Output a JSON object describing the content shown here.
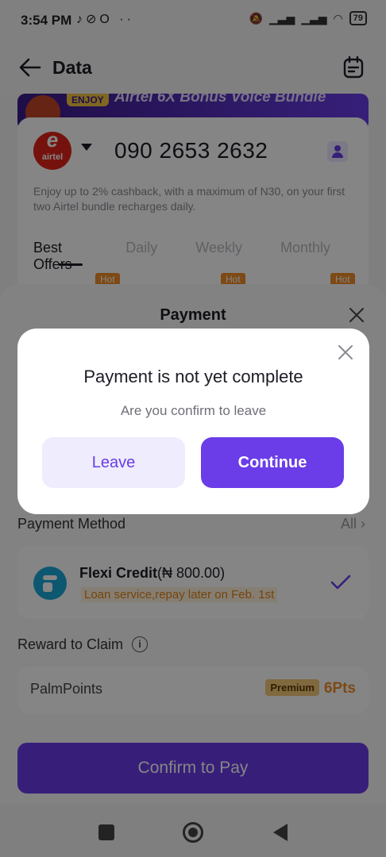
{
  "status_bar": {
    "time": "3:54 PM",
    "left_icons": [
      "tiktok-icon",
      "no-entry-icon",
      "opera-icon",
      "more-dots-icon"
    ],
    "battery": "79"
  },
  "app_bar": {
    "title": "Data"
  },
  "promo": {
    "badge": "ENJOY",
    "text": "Airtel 6X Bonus Voice Bundle"
  },
  "phone_card": {
    "carrier": "airtel",
    "number": "090 2653 2632",
    "cashback_note": "Enjoy up to 2% cashback, with a maximum of N30, on your first two Airtel bundle recharges daily.",
    "tabs": [
      "Best Offers",
      "Daily",
      "Weekly",
      "Monthly"
    ],
    "hot_label": "Hot"
  },
  "sheet": {
    "title": "Payment",
    "payment_method_label": "Payment Method",
    "all_label": "All",
    "method": {
      "name": "Flexi Credit",
      "amount": "(₦ 800.00)",
      "note": "Loan service,repay later on Feb. 1st"
    },
    "reward_label": "Reward to Claim",
    "points": {
      "name": "PalmPoints",
      "badge": "Premium",
      "value": "6Pts"
    },
    "confirm_label": "Confirm to Pay"
  },
  "dialog": {
    "title": "Payment is not yet complete",
    "subtitle": "Are you confirm to leave",
    "leave_label": "Leave",
    "continue_label": "Continue"
  },
  "colors": {
    "accent": "#6a3de8",
    "accent_light": "#efecfd",
    "airtel_red": "#e2231a",
    "orange": "#f08c28"
  }
}
